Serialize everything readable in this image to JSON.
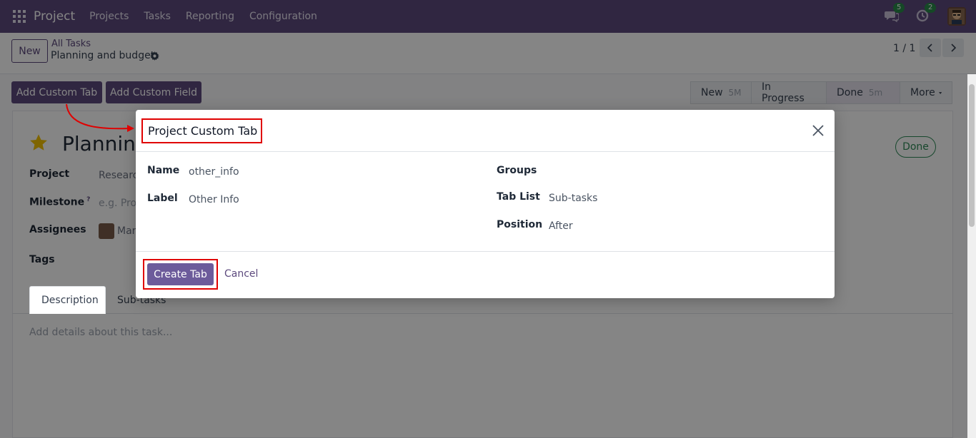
{
  "navbar": {
    "brand": "Project",
    "menu": [
      "Projects",
      "Tasks",
      "Reporting",
      "Configuration"
    ],
    "chat_count": "5",
    "activity_count": "2"
  },
  "control": {
    "new_label": "New",
    "breadcrumb_parent": "All Tasks",
    "breadcrumb_current": "Planning and budget",
    "pager": "1 / 1"
  },
  "actions": {
    "add_custom_tab": "Add Custom Tab",
    "add_custom_field": "Add Custom Field"
  },
  "statusbar": {
    "stages": [
      {
        "label": "New",
        "time": "5M"
      },
      {
        "label": "In Progress",
        "time": ""
      },
      {
        "label": "Done",
        "time": "5m"
      }
    ],
    "more_label": "More"
  },
  "form": {
    "title": "Planning",
    "done_badge": "Done",
    "project_label": "Project",
    "project_value": "Research",
    "milestone_label": "Milestone",
    "milestone_hint": "?",
    "milestone_placeholder": "e.g. Prod",
    "assignees_label": "Assignees",
    "assignee_value": "Marc",
    "tags_label": "Tags",
    "tabs": [
      "Description",
      "Sub-tasks"
    ],
    "description_placeholder": "Add details about this task..."
  },
  "dialog": {
    "title": "Project Custom Tab",
    "name_label": "Name",
    "name_value": "other_info",
    "label_label": "Label",
    "label_value": "Other Info",
    "groups_label": "Groups",
    "groups_value": "",
    "tab_list_label": "Tab List",
    "tab_list_value": "Sub-tasks",
    "position_label": "Position",
    "position_value": "After",
    "create_label": "Create Tab",
    "cancel_label": "Cancel"
  },
  "colors": {
    "primary": "#5d4a7e",
    "highlight": "#e00000",
    "success": "#2e8b57"
  }
}
